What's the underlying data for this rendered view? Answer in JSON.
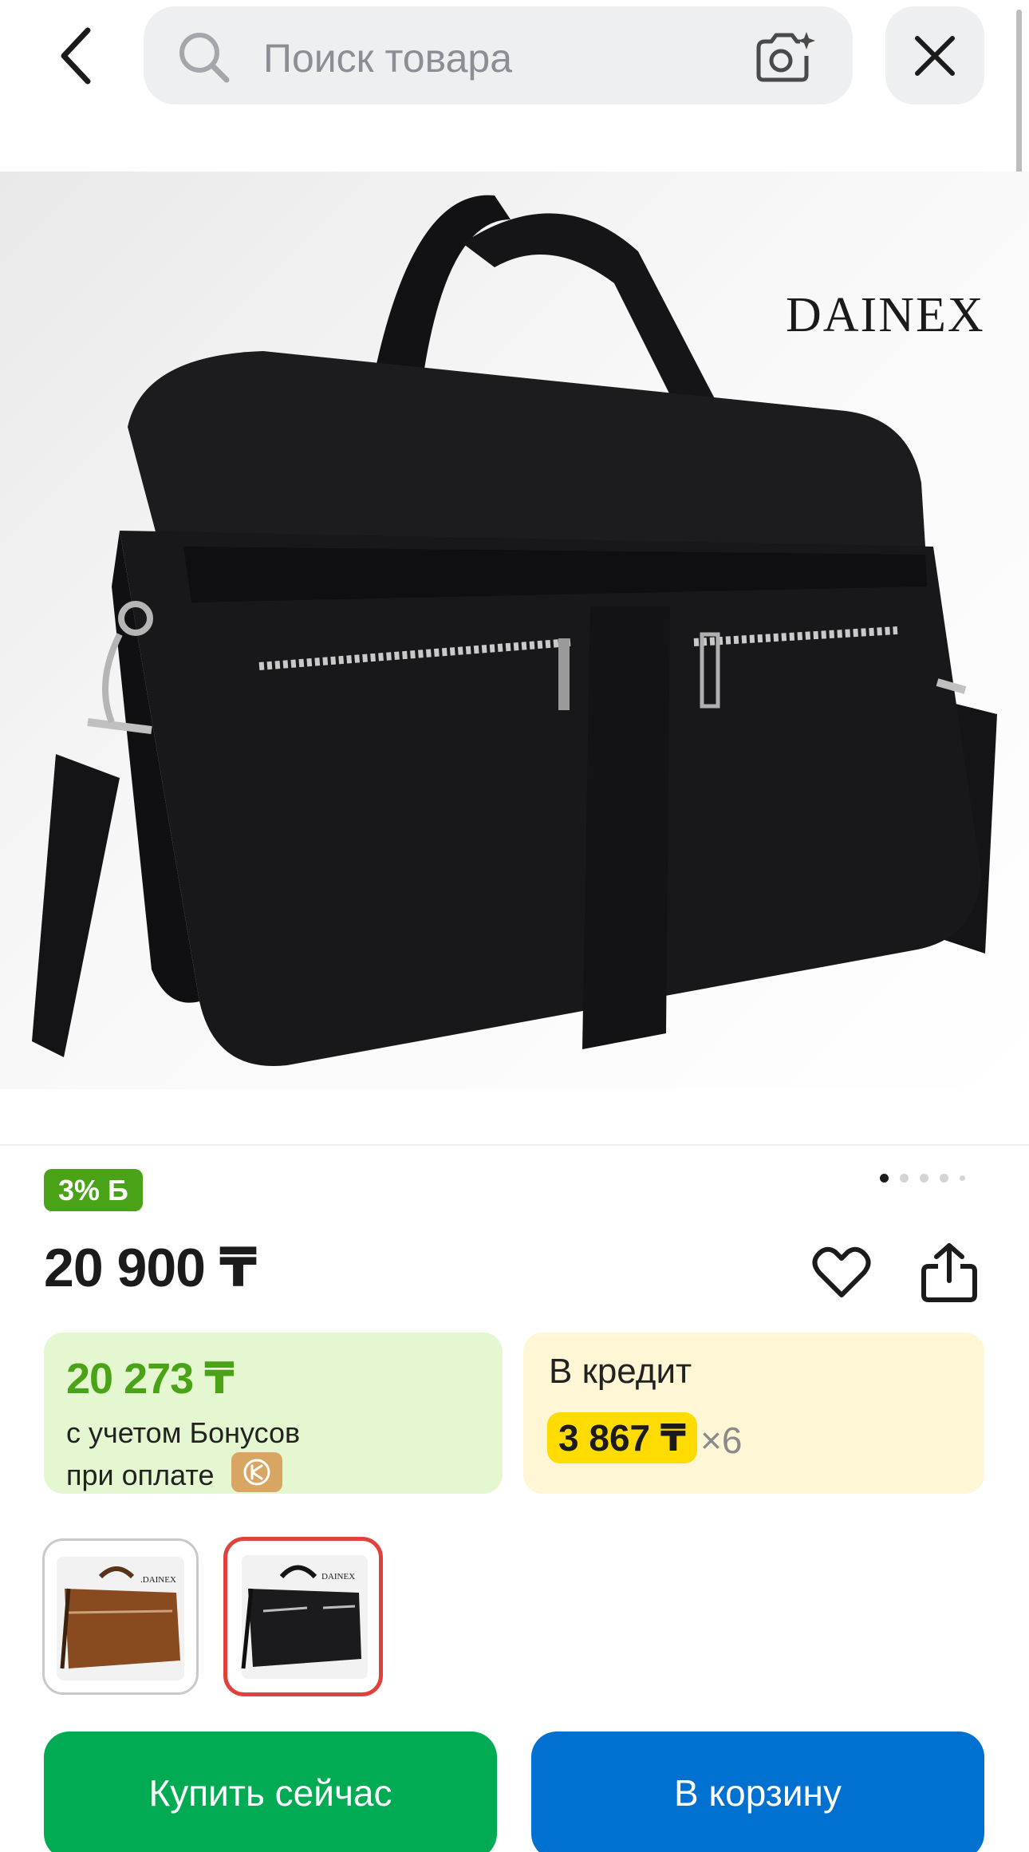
{
  "search": {
    "placeholder": "Поиск товара"
  },
  "product": {
    "brand_watermark": "DAINEX",
    "bonus_badge": "3% Б",
    "price": "20 900 ₸",
    "gallery": {
      "total_images": 5,
      "current_index": 1
    }
  },
  "bonus_card": {
    "amount": "20 273 ₸",
    "line1": "с учетом Бонусов",
    "line2": "при оплате"
  },
  "credit_card": {
    "label": "В кредит",
    "monthly": "3 867 ₸",
    "times": "×6"
  },
  "variants": [
    {
      "color": "brown",
      "brand": "DAINEX",
      "selected": false
    },
    {
      "color": "black",
      "brand": "DAINEX",
      "selected": true
    }
  ],
  "actions": {
    "buy_now": "Купить сейчас",
    "add_to_cart": "В корзину"
  },
  "colors": {
    "bonus_green": "#4aa316",
    "credit_yellow": "#ffdb00",
    "buy_green": "#00ab53",
    "cart_blue": "#0071d0",
    "selected_border": "#e0413a"
  },
  "icons": [
    "back-arrow-icon",
    "search-icon",
    "camera-search-icon",
    "close-icon",
    "heart-icon",
    "share-icon",
    "wallet-icon"
  ]
}
